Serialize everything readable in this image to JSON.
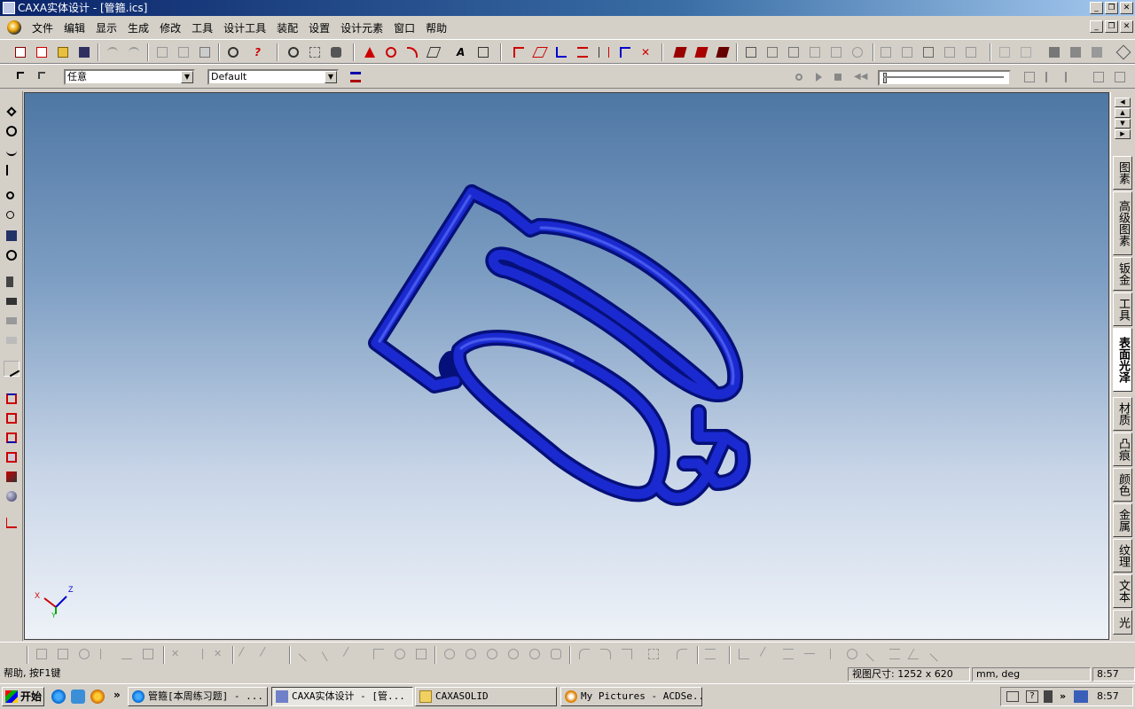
{
  "window": {
    "title": "CAXA实体设计 - [管箍.ics]",
    "buttons": [
      "_",
      "❐",
      "✕"
    ]
  },
  "menu": {
    "items": [
      "文件",
      "编辑",
      "显示",
      "生成",
      "修改",
      "工具",
      "设计工具",
      "装配",
      "设置",
      "设计元素",
      "窗口",
      "帮助"
    ]
  },
  "toolbar2": {
    "filter_value": "任意",
    "style_value": "Default"
  },
  "right_tabs": [
    "图素",
    "高级图素",
    "钣金",
    "工具",
    "表面光泽",
    "材质",
    "凸痕",
    "颜色",
    "金属",
    "纹理",
    "文本",
    "光"
  ],
  "right_tabs_active": "表面光泽",
  "axis": {
    "x": "X",
    "y": "Y",
    "z": "Z"
  },
  "status": {
    "help": "帮助, 按F1键",
    "view_size": "视图尺寸: 1252 x  620",
    "units": "mm, deg",
    "time": "8:57"
  },
  "taskbar": {
    "start": "开始",
    "chevron": "»",
    "tasks": [
      {
        "label": "管箍[本周练习题] - ...",
        "active": false
      },
      {
        "label": "CAXA实体设计 - [管...",
        "active": true
      },
      {
        "label": "CAXASOLID",
        "active": false
      },
      {
        "label": "My Pictures - ACDSe...",
        "active": false
      }
    ],
    "tray_time": "8:57"
  },
  "colors": {
    "model": "#0c15b0",
    "title_active": "#0a246a"
  }
}
